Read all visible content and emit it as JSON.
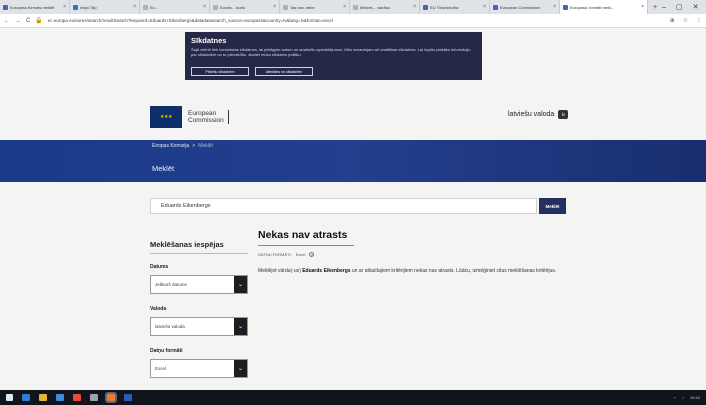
{
  "browser": {
    "tabs": [
      {
        "label": "Europass formats meklēt",
        "color": "#4267b2"
      },
      {
        "label": "Ieeja Tāp",
        "color": "#3a6ec9"
      },
      {
        "label": "Eu...",
        "color": "#aab1bb"
      },
      {
        "label": "Eurofu... kurtu",
        "color": "#aab1bb"
      },
      {
        "label": "Tas nav..nebe",
        "color": "#aab1bb"
      },
      {
        "label": "Mekles... vairāku",
        "color": "#aab1bb"
      },
      {
        "label": "EU Tirdzniecība",
        "color": "#4267b2"
      },
      {
        "label": "European Commission",
        "color": "#4267b2"
      },
      {
        "label": "Europass: formāti mekl...",
        "color": "#4267b2"
      }
    ],
    "new_tab": "+",
    "window_controls": [
      "–",
      "▢",
      "✕"
    ],
    "url": "ec.europa.eu/eures/search/resultSearch?keyword=Eduards+Eikenbergs&datadatasearch_source=europass&country=lv&lang=lv&format=excel",
    "nav": {
      "back": "←",
      "forward": "→",
      "reload": "C"
    }
  },
  "cookie": {
    "title": "Sīkdatnes",
    "text": "Šajā vietnē tiek izmantotas sīkdatnes, lai pielāgotu saturu un analizētu apmeklējumus. Mēs izmantojam arī analītikas sīkdatnes. Lai iegūtu plašāku informāciju par sīkdatnēm un to pārvaldību, skatiet mūsu sīkdatņu politiku.",
    "accept": "Piekrītu sīkdatnēm",
    "decline": "Atteikties no sīkdatnēm"
  },
  "header": {
    "logo_line1": "European",
    "logo_line2": "Commission",
    "language": "latviešu valoda",
    "language_code": "lv"
  },
  "bluebar": {
    "crumb_home": "Eiropas Komisija",
    "crumb_sep": ">",
    "crumb_current": "Meklēt",
    "title": "Meklēt"
  },
  "search": {
    "query": "Eduards Eikenbergs",
    "button": "Meklēt"
  },
  "sidebar": {
    "title": "Meklēšanas iespējas",
    "filters": [
      {
        "label": "Datums",
        "value": "Jebkurš datums"
      },
      {
        "label": "Valoda",
        "value": "latviešu valoda"
      },
      {
        "label": "Datņu formāti",
        "value": "Excel"
      }
    ]
  },
  "result": {
    "title": "Nekas nav atrasts",
    "filter_label": "DATŅU FORMĀTI:",
    "filter_value": "Excel",
    "text_prefix": "Meklējot vārdu(-us) ",
    "query": "Eduards Eikenbergs",
    "text_suffix": " un ar atlasītajiem kritērijiem nekas nav atrasts. Lūdzu, izmēģiniet citus meklēšanas kritērijus."
  },
  "taskbar": {
    "icons": [
      "windows-logo",
      "edge",
      "file-explorer",
      "mail",
      "chrome",
      "settings",
      "firefox",
      "word"
    ],
    "tray": "10:42"
  }
}
